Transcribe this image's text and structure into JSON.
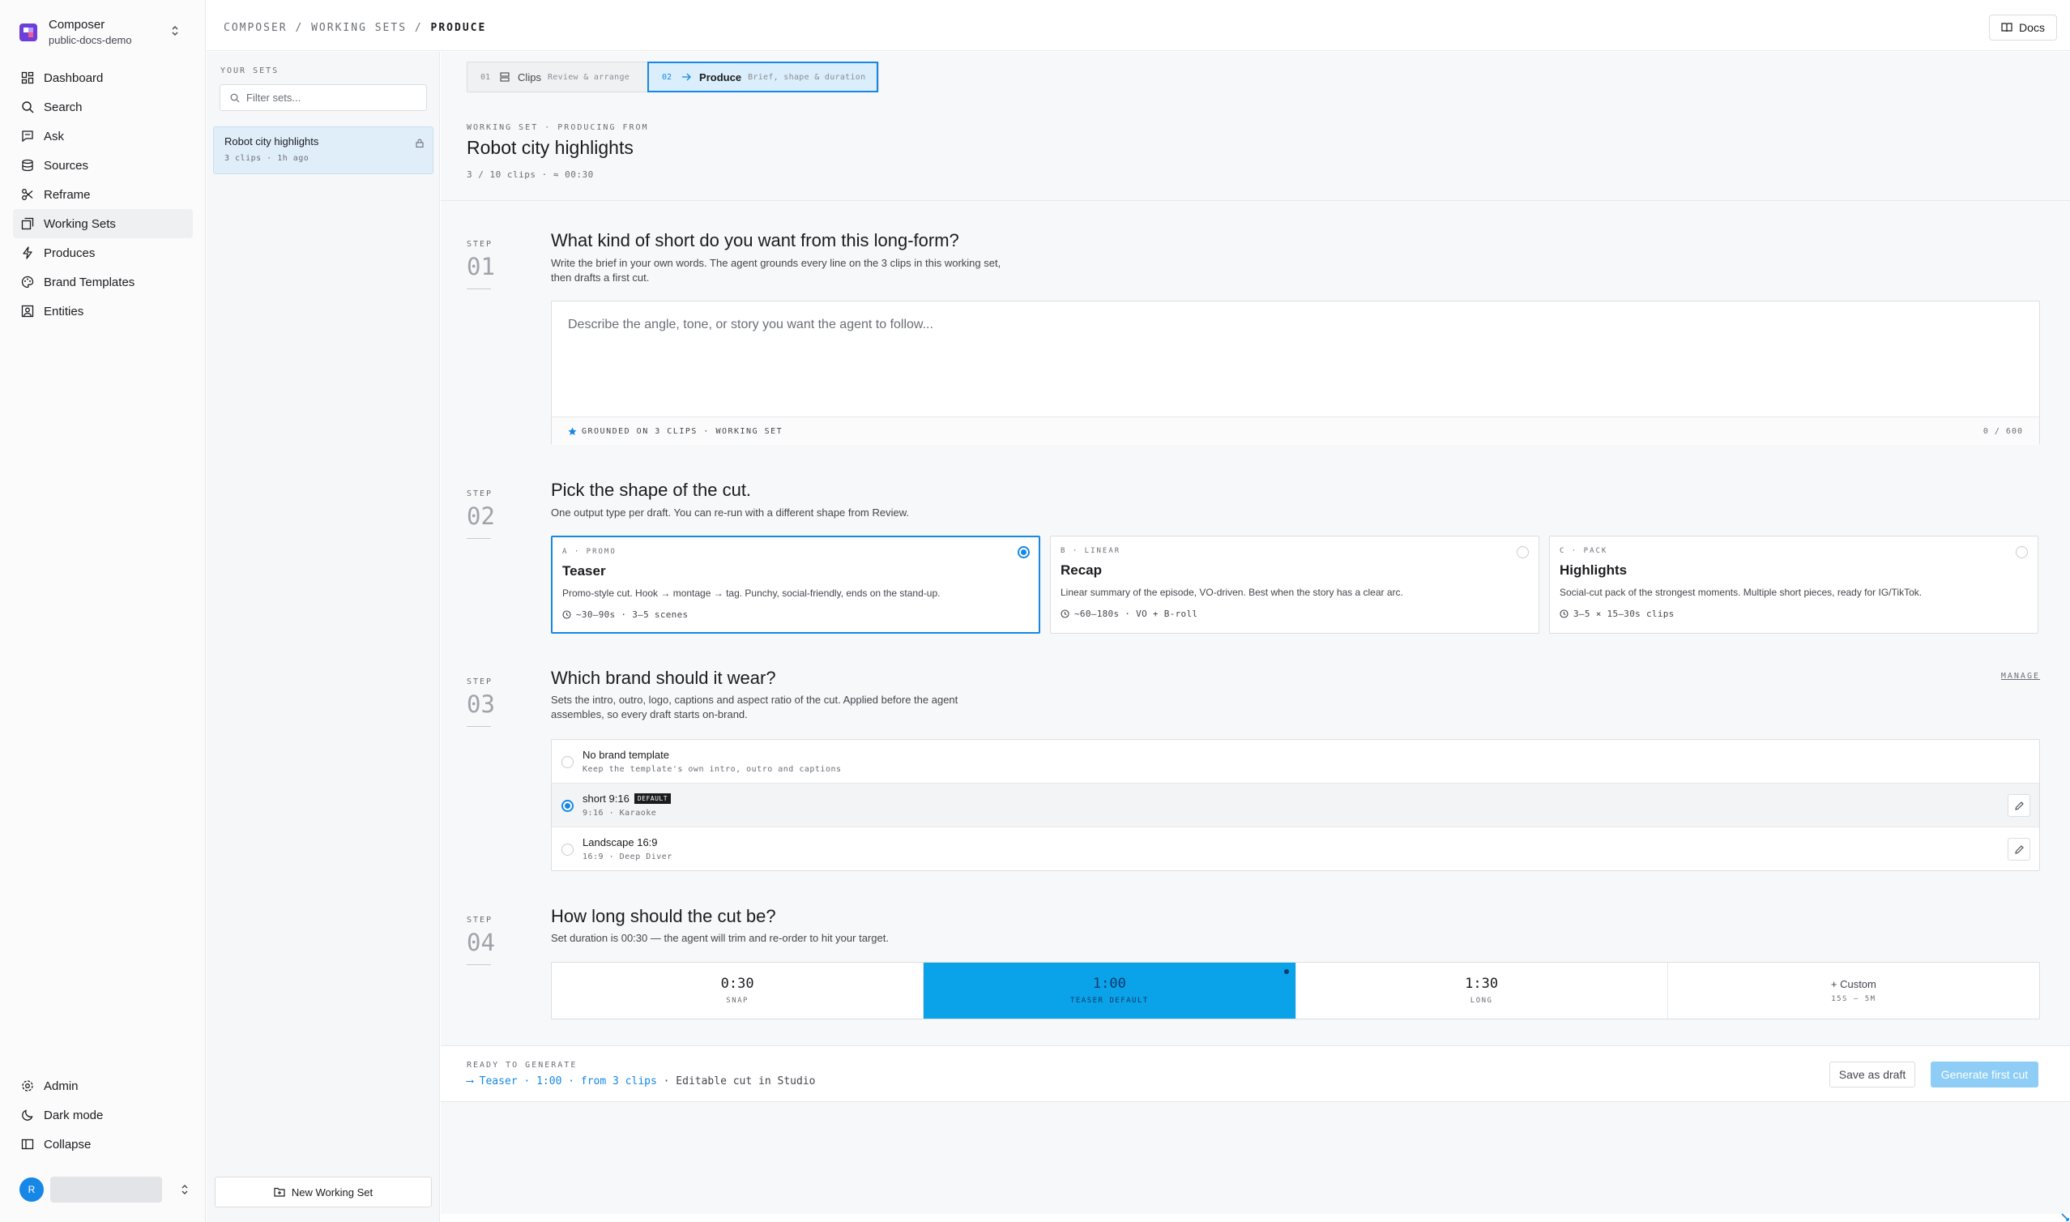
{
  "workspace": {
    "name": "Composer",
    "sub": "public-docs-demo"
  },
  "nav": [
    {
      "label": "Dashboard",
      "icon": "dashboard-icon"
    },
    {
      "label": "Search",
      "icon": "search-icon"
    },
    {
      "label": "Ask",
      "icon": "chat-icon"
    },
    {
      "label": "Sources",
      "icon": "database-icon"
    },
    {
      "label": "Reframe",
      "icon": "scissors-icon"
    },
    {
      "label": "Working Sets",
      "icon": "stack-icon",
      "active": true
    },
    {
      "label": "Produces",
      "icon": "bolt-icon"
    },
    {
      "label": "Brand Templates",
      "icon": "palette-icon"
    },
    {
      "label": "Entities",
      "icon": "person-icon"
    }
  ],
  "nav_bottom": [
    {
      "label": "Admin",
      "icon": "gear-icon"
    },
    {
      "label": "Dark mode",
      "icon": "moon-icon"
    },
    {
      "label": "Collapse",
      "icon": "panel-icon"
    }
  ],
  "user": {
    "initial": "R"
  },
  "breadcrumb": {
    "a": "COMPOSER",
    "sep": "/",
    "b": "WORKING SETS",
    "c": "PRODUCE"
  },
  "docs_label": "Docs",
  "sets": {
    "label": "YOUR SETS",
    "filter_placeholder": "Filter sets...",
    "items": [
      {
        "title": "Robot city highlights",
        "meta": "3 clips · 1h ago"
      }
    ],
    "new_label": "New Working Set"
  },
  "tabs": [
    {
      "num": "01",
      "label": "Clips",
      "sub": "Review & arrange"
    },
    {
      "num": "02",
      "label": "Produce",
      "sub": "Brief, shape & duration"
    }
  ],
  "header": {
    "kicker": "WORKING SET · PRODUCING FROM",
    "title": "Robot city highlights",
    "meta": "3 / 10 clips  ·  ≈ 00:30"
  },
  "step_label": "STEP",
  "step1": {
    "num": "01",
    "title": "What kind of short do you want from this long-form?",
    "desc_1": "Write the brief in your own words. The agent grounds every line on the 3 clips in this working set,",
    "desc_2": "then drafts a first cut.",
    "placeholder": "Describe the angle, tone, or story you want the agent to follow...",
    "grounded": "GROUNDED ON 3 CLIPS · WORKING SET",
    "counter": "0 / 600"
  },
  "step2": {
    "num": "02",
    "title": "Pick the shape of the cut.",
    "desc": "One output type per draft. You can re-run with a different shape from Review.",
    "options": [
      {
        "kicker": "A · PROMO",
        "title": "Teaser",
        "desc": "Promo-style cut. Hook → montage → tag. Punchy, social-friendly, ends on the stand-up.",
        "meta": "~30–90s · 3–5 scenes",
        "selected": true
      },
      {
        "kicker": "B · LINEAR",
        "title": "Recap",
        "desc": "Linear summary of the episode, VO-driven. Best when the story has a clear arc.",
        "meta": "~60–180s · VO + B-roll",
        "selected": false
      },
      {
        "kicker": "C · PACK",
        "title": "Highlights",
        "desc": "Social-cut pack of the strongest moments. Multiple short pieces, ready for IG/TikTok.",
        "meta": "3–5 × 15–30s clips",
        "selected": false
      }
    ]
  },
  "step3": {
    "num": "03",
    "title": "Which brand should it wear?",
    "desc_1": "Sets the intro, outro, logo, captions and aspect ratio of the cut. Applied before the agent",
    "desc_2": "assembles, so every draft starts on-brand.",
    "manage": "MANAGE",
    "options": [
      {
        "title": "No brand template",
        "sub": "Keep the template's own intro, outro and captions",
        "selected": false,
        "badge": ""
      },
      {
        "title": "short 9:16",
        "sub": "9:16 · Karaoke",
        "selected": true,
        "badge": "DEFAULT"
      },
      {
        "title": "Landscape 16:9",
        "sub": "16:9 · Deep Diver",
        "selected": false,
        "badge": ""
      }
    ]
  },
  "step4": {
    "num": "04",
    "title": "How long should the cut be?",
    "desc": "Set duration is 00:30 — the agent will trim and re-order to hit your target.",
    "options": [
      {
        "value": "0:30",
        "sub": "SNAP",
        "selected": false
      },
      {
        "value": "1:00",
        "sub": "TEASER DEFAULT",
        "selected": true
      },
      {
        "value": "1:30",
        "sub": "LONG",
        "selected": false
      },
      {
        "value": "+ Custom",
        "sub": "15S – 5M",
        "selected": false
      }
    ]
  },
  "generate": {
    "kicker": "READY TO GENERATE",
    "summary_a": "⟶ Teaser · 1:00 · from 3 clips",
    "summary_b": " · Editable cut in Studio",
    "draft_label": "Save as draft",
    "generate_label": "Generate first cut"
  },
  "colors": {
    "accent": "#1687e6",
    "selected_duration": "#0aa2e8",
    "brand_logo": "#6d3fd9"
  }
}
